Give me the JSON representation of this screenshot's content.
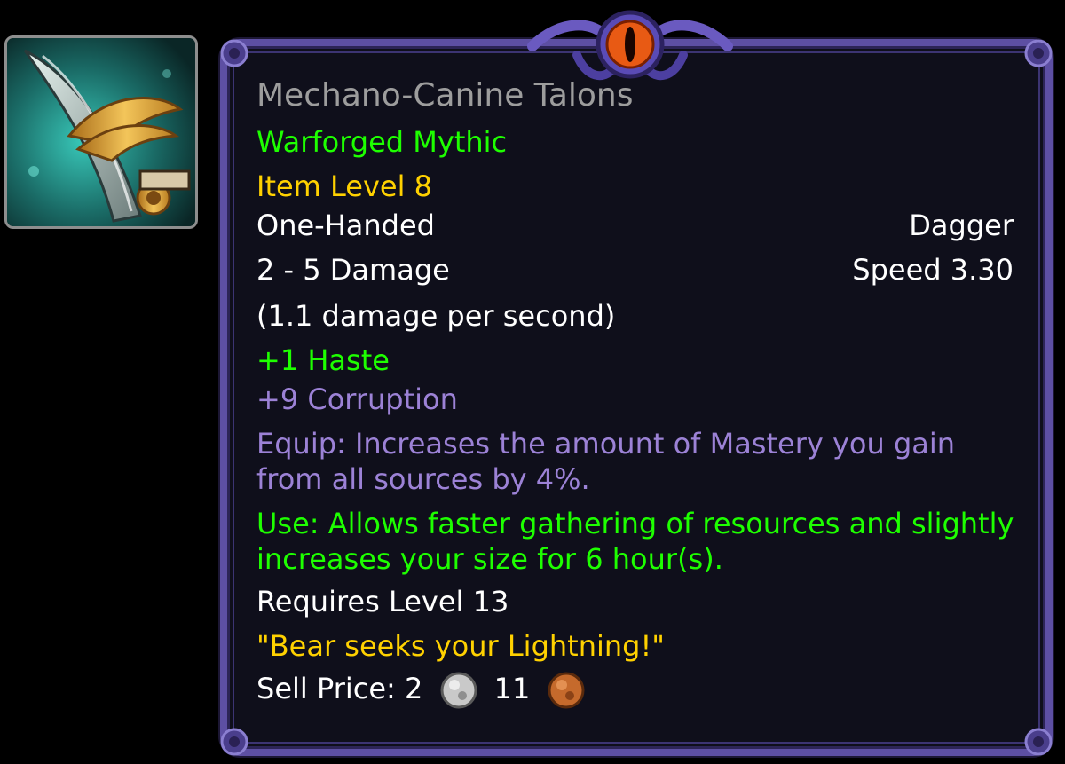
{
  "item": {
    "name": "Mechano-Canine Talons",
    "quality": "Warforged Mythic",
    "item_level": "Item Level 8",
    "slot": "One-Handed",
    "type": "Dagger",
    "damage": "2 - 5 Damage",
    "speed": "Speed 3.30",
    "dps": "(1.1 damage per second)",
    "stat_haste": "+1 Haste",
    "stat_corruption": "+9 Corruption",
    "equip_effect": "Equip: Increases the amount of Mastery you gain from all sources by 4%.",
    "use_effect": "Use: Allows faster gathering of resources and slightly increases your size for 6 hour(s).",
    "requirement": "Requires Level 13",
    "flavor": "\"Bear seeks your Lightning!\"",
    "sell_label": "Sell Price:",
    "sell_silver": "2",
    "sell_copper": "11",
    "icon": "dagger-claw-icon"
  },
  "colors": {
    "name": "#9d9d9d",
    "green": "#1eff00",
    "yellow": "#ffd100",
    "white": "#ffffff",
    "purple": "#9c82d6",
    "frame": "#5d4fa3",
    "background": "#0f0f1b"
  }
}
